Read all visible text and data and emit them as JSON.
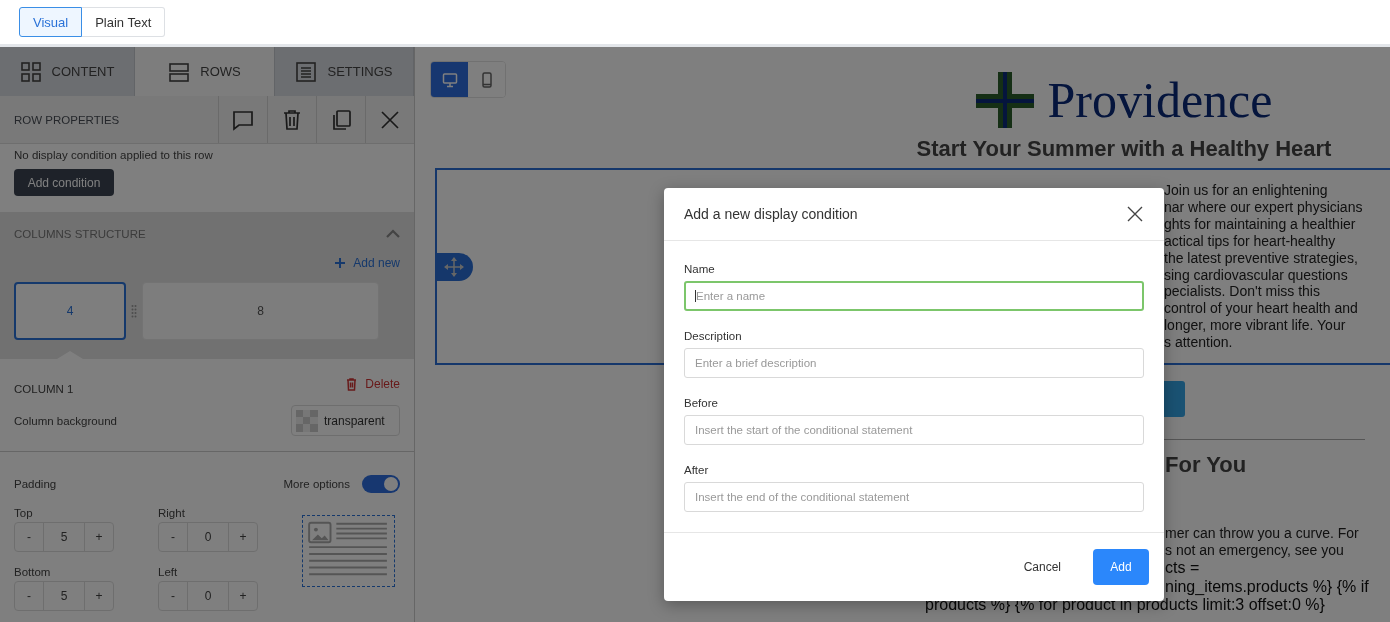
{
  "editor_mode_tabs": [
    {
      "label": "Visual",
      "selected": true
    },
    {
      "label": "Plain Text",
      "selected": false
    }
  ],
  "sidebar": {
    "tabs": [
      {
        "label": "CONTENT",
        "selected": false
      },
      {
        "label": "ROWS",
        "selected": true
      },
      {
        "label": "SETTINGS",
        "selected": false
      }
    ],
    "row_properties": {
      "title": "ROW PROPERTIES",
      "condition_text": "No display condition applied to this row",
      "add_condition_button": "Add condition"
    },
    "columns_structure": {
      "title": "COLUMNS STRUCTURE",
      "expanded": true,
      "add_new": "Add new",
      "columns": [
        {
          "label": "4",
          "selected": true
        },
        {
          "label": "8",
          "selected": false
        }
      ]
    },
    "column": {
      "title": "COLUMN 1",
      "delete": "Delete",
      "background_label": "Column background",
      "background_value": "transparent"
    },
    "padding": {
      "title": "Padding",
      "more_options_label": "More options",
      "more_options_on": true,
      "fields": [
        {
          "label": "Top",
          "value": "5",
          "decrement": "-",
          "increment": "+"
        },
        {
          "label": "Right",
          "value": "0",
          "decrement": "-",
          "increment": "+"
        },
        {
          "label": "Bottom",
          "value": "5",
          "decrement": "-",
          "increment": "+"
        },
        {
          "label": "Left",
          "value": "0",
          "decrement": "-",
          "increment": "+"
        }
      ]
    }
  },
  "canvas": {
    "device_toggle": [
      {
        "selected": true
      },
      {
        "selected": false
      }
    ],
    "email": {
      "logo_text": "Providence",
      "heading": "Start Your Summer with a Healthy Heart",
      "row_text_lines": [
        "Join us for an enlightening",
        "nar where our expert physicians",
        "ghts for maintaining a healthier",
        "actical tips for heart-healthy",
        "the latest preventive strategies,",
        "sing cardiovascular questions",
        "pecialists. Don't miss this",
        "control of your heart health and",
        "longer, more vibrant life. Your",
        "s attention."
      ],
      "section_heading": "For You",
      "paragraph_lines": [
        "mer can throw you a curve. For",
        "s not an emergency, see you"
      ],
      "code_lines": [
        "cts =",
        "ning_items.products %} {% if"
      ],
      "code_last_line": "products %} {% for product in products limit:3 offset:0 %}"
    }
  },
  "modal": {
    "title": "Add a new display condition",
    "fields": [
      {
        "label": "Name",
        "placeholder": "Enter a name",
        "focused": true
      },
      {
        "label": "Description",
        "placeholder": "Enter a brief description",
        "focused": false
      },
      {
        "label": "Before",
        "placeholder": "Insert the start of the conditional statement",
        "focused": false
      },
      {
        "label": "After",
        "placeholder": "Insert the end of the conditional statement",
        "focused": false
      }
    ],
    "cancel_button": "Cancel",
    "confirm_button": "Add"
  }
}
